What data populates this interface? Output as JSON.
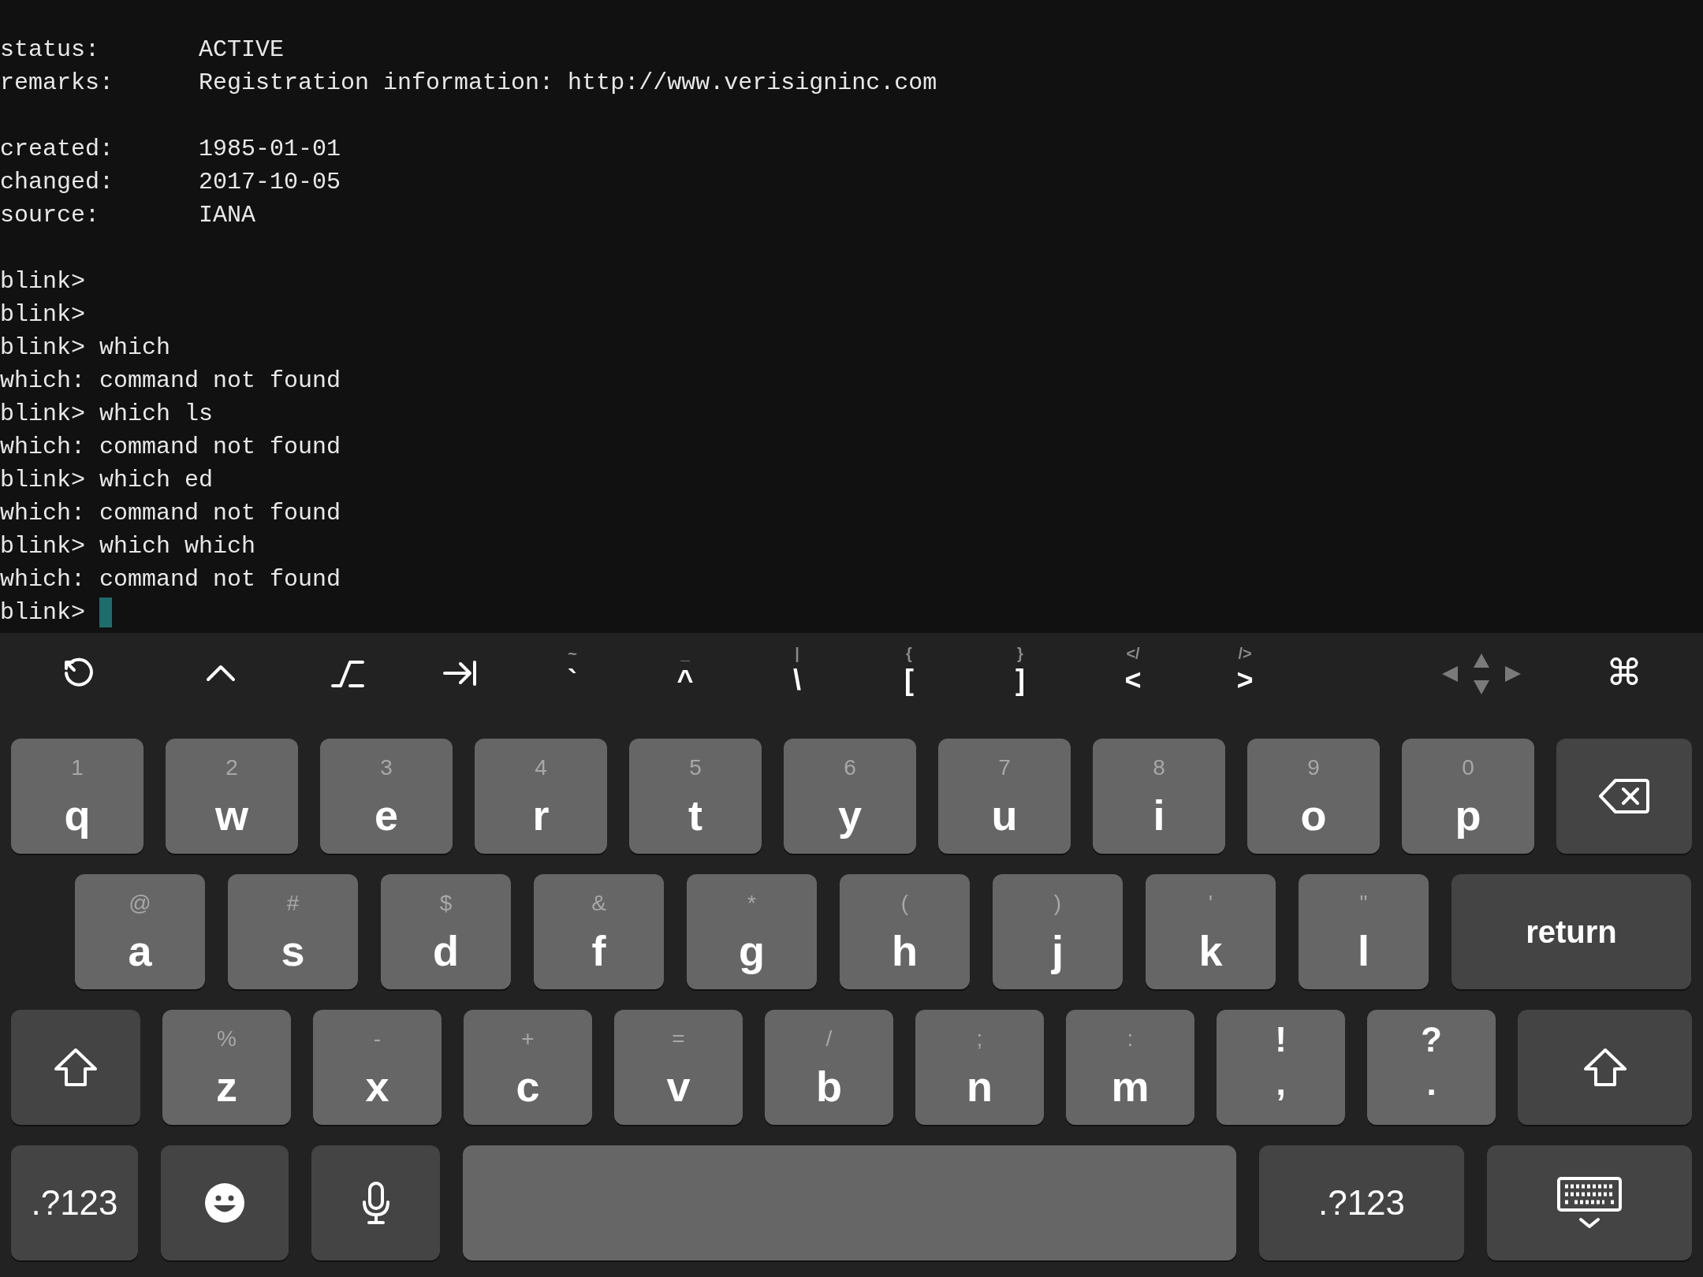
{
  "terminal": {
    "blocks": [
      [
        "status:       ACTIVE",
        "remarks:      Registration information: http://www.verisigninc.com"
      ],
      [
        "created:      1985-01-01",
        "changed:      2017-10-05",
        "source:       IANA"
      ],
      [
        "blink>",
        "blink>",
        "blink> which",
        "which: command not found",
        "blink> which ls",
        "which: command not found",
        "blink> which ed",
        "which: command not found",
        "blink> which which",
        "which: command not found",
        "blink> "
      ]
    ]
  },
  "toolbar": {
    "keys": [
      {
        "hint": "~",
        "label": "`"
      },
      {
        "hint": "_",
        "label": "^"
      },
      {
        "hint": "|",
        "label": "\\"
      },
      {
        "hint": "{",
        "label": "["
      },
      {
        "hint": "}",
        "label": "]"
      },
      {
        "hint": "</",
        "label": "<"
      },
      {
        "hint": "/>",
        "label": ">"
      }
    ],
    "command_key": "⌘"
  },
  "keyboard": {
    "rows": [
      [
        {
          "kind": "letter",
          "hint": "1",
          "label": "q"
        },
        {
          "kind": "letter",
          "hint": "2",
          "label": "w"
        },
        {
          "kind": "letter",
          "hint": "3",
          "label": "e"
        },
        {
          "kind": "letter",
          "hint": "4",
          "label": "r"
        },
        {
          "kind": "letter",
          "hint": "5",
          "label": "t"
        },
        {
          "kind": "letter",
          "hint": "6",
          "label": "y"
        },
        {
          "kind": "letter",
          "hint": "7",
          "label": "u"
        },
        {
          "kind": "letter",
          "hint": "8",
          "label": "i"
        },
        {
          "kind": "letter",
          "hint": "9",
          "label": "o"
        },
        {
          "kind": "letter",
          "hint": "0",
          "label": "p"
        },
        {
          "kind": "delete"
        }
      ],
      [
        {
          "kind": "letter",
          "hint": "@",
          "label": "a"
        },
        {
          "kind": "letter",
          "hint": "#",
          "label": "s"
        },
        {
          "kind": "letter",
          "hint": "$",
          "label": "d"
        },
        {
          "kind": "letter",
          "hint": "&",
          "label": "f"
        },
        {
          "kind": "letter",
          "hint": "*",
          "label": "g"
        },
        {
          "kind": "letter",
          "hint": "(",
          "label": "h"
        },
        {
          "kind": "letter",
          "hint": ")",
          "label": "j"
        },
        {
          "kind": "letter",
          "hint": "'",
          "label": "k"
        },
        {
          "kind": "letter",
          "hint": "\"",
          "label": "l"
        },
        {
          "kind": "return",
          "label": "return"
        }
      ],
      [
        {
          "kind": "shift"
        },
        {
          "kind": "letter",
          "hint": "%",
          "label": "z"
        },
        {
          "kind": "letter",
          "hint": "-",
          "label": "x"
        },
        {
          "kind": "letter",
          "hint": "+",
          "label": "c"
        },
        {
          "kind": "letter",
          "hint": "=",
          "label": "v"
        },
        {
          "kind": "letter",
          "hint": "/",
          "label": "b"
        },
        {
          "kind": "letter",
          "hint": ";",
          "label": "n"
        },
        {
          "kind": "letter",
          "hint": ":",
          "label": "m"
        },
        {
          "kind": "punct",
          "hint": "!",
          "label": ","
        },
        {
          "kind": "punct",
          "hint": "?",
          "label": "."
        },
        {
          "kind": "shift"
        }
      ],
      [
        {
          "kind": "mode",
          "label": ".?123"
        },
        {
          "kind": "emoji"
        },
        {
          "kind": "mic"
        },
        {
          "kind": "space"
        },
        {
          "kind": "mode",
          "label": ".?123"
        },
        {
          "kind": "hide"
        }
      ]
    ]
  }
}
